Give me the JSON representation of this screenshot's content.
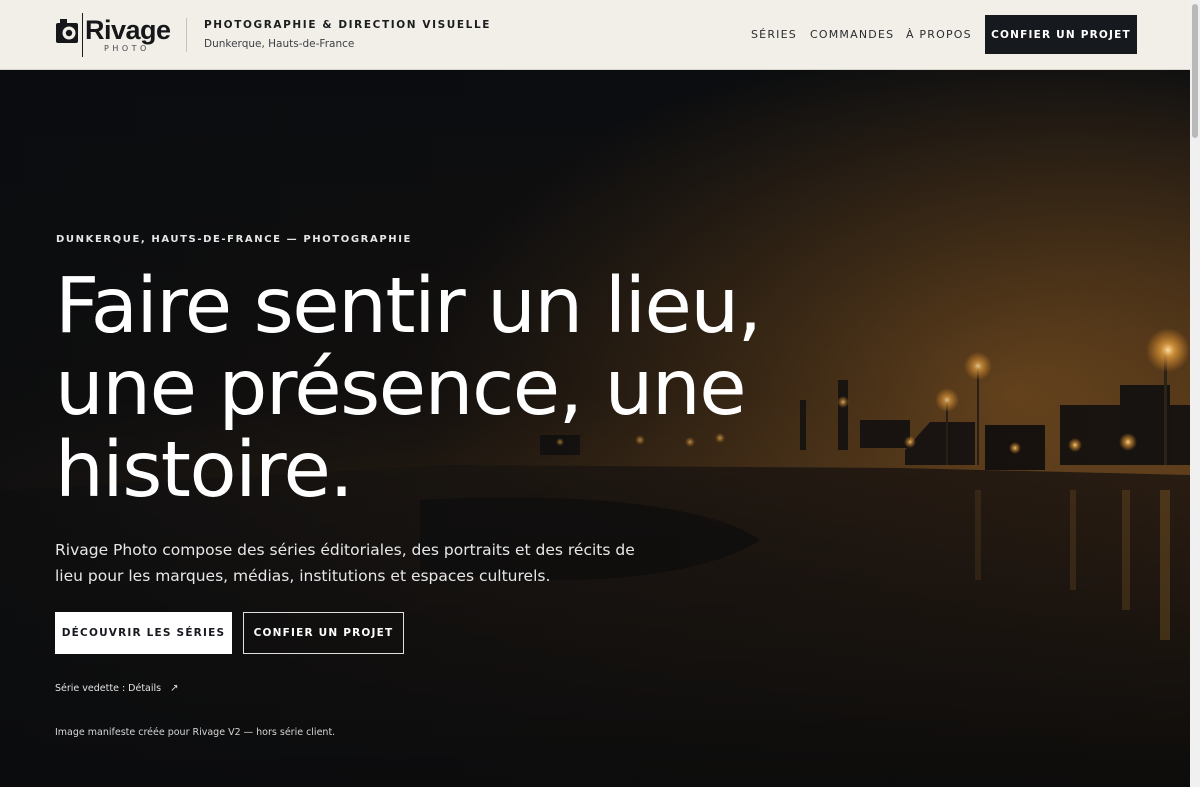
{
  "brand": {
    "name": "Rivage",
    "sub": "PHOTO",
    "tagline": "PHOTOGRAPHIE & DIRECTION VISUELLE",
    "location": "Dunkerque, Hauts-de-France"
  },
  "nav": {
    "items": [
      {
        "label": "SÉRIES"
      },
      {
        "label": "COMMANDES"
      },
      {
        "label": "À PROPOS"
      }
    ],
    "cta": "CONFIER UN PROJET"
  },
  "hero": {
    "kicker": "DUNKERQUE, HAUTS-DE-FRANCE — PHOTOGRAPHIE",
    "headline": "Faire sentir un lieu, une présence, une histoire.",
    "intro": "Rivage Photo compose des séries éditoriales, des portraits et des récits de lieu pour les marques, médias, institutions et espaces culturels.",
    "primary_button": "DÉCOUVRIR LES SÉRIES",
    "secondary_button": "CONFIER UN PROJET",
    "featured_link": "Série vedette : Détails",
    "featured_arrow": "↗",
    "caption": "Image manifeste créée pour Rivage V2 — hors série client."
  },
  "colors": {
    "header_bg": "#f2efe8",
    "dark": "#16191d",
    "light_glow": "#ffb347"
  }
}
